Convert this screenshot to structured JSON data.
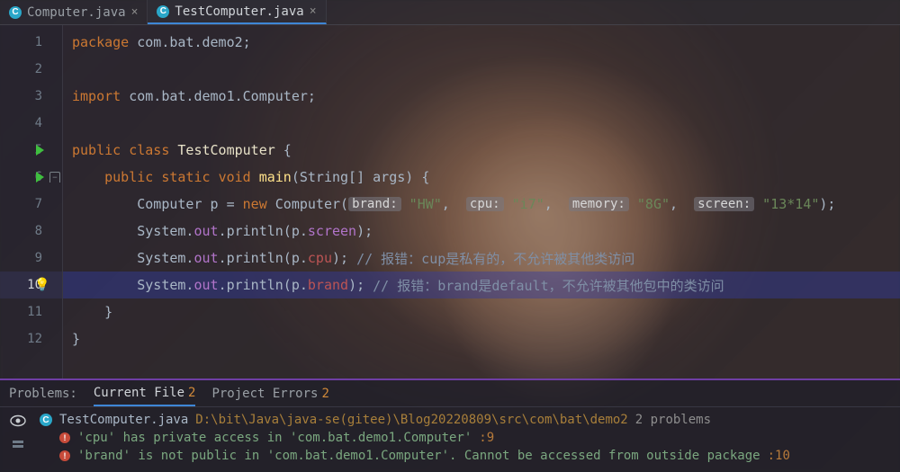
{
  "tabs": [
    {
      "label": "Computer.java",
      "active": false
    },
    {
      "label": "TestComputer.java",
      "active": true
    }
  ],
  "code": {
    "line1_pkg_kw": "package",
    "line1_pkg_val": "com.bat.demo2",
    "line3_imp_kw": "import",
    "line3_imp_val": "com.bat.demo1.Computer",
    "line5_public": "public",
    "line5_class": "class",
    "line5_name": "TestComputer",
    "line6_public": "public",
    "line6_static": "static",
    "line6_void": "void",
    "line6_main": "main",
    "line6_sig": "(String[] args) {",
    "line7_var": "Computer p ",
    "line7_eq": "= ",
    "line7_new": "new",
    "line7_ctor": " Computer(",
    "hint_brand": "brand:",
    "arg_brand": "\"HW\"",
    "hint_cpu": "cpu:",
    "arg_cpu": "\"i7\"",
    "hint_memory": "memory:",
    "arg_memory": "\"8G\"",
    "hint_screen": "screen:",
    "arg_screen": "\"13*14\"",
    "line7_end": ");",
    "sysout_pre": "System.",
    "sysout_out": "out",
    "sysout_call": ".println(p.",
    "f_screen": "screen",
    "f_cpu": "cpu",
    "f_brand": "brand",
    "close_paren": ");",
    "comment9": " // 报错：cup是私有的，不允许被其他类访问",
    "comment10": " // 报错：brand是default，不允许被其他包中的类访问",
    "brace_close": "}"
  },
  "gutter": [
    "1",
    "2",
    "3",
    "4",
    "5",
    "6",
    "7",
    "8",
    "9",
    "10",
    "11",
    "12"
  ],
  "problems": {
    "label": "Problems:",
    "tab_current": "Current File",
    "tab_current_count": "2",
    "tab_project": "Project Errors",
    "tab_project_count": "2",
    "file": "TestComputer.java",
    "path": "D:\\bit\\Java\\java-se(gitee)\\Blog20220809\\src\\com\\bat\\demo2",
    "count": "2 problems",
    "items": [
      {
        "msg": "'cpu' has private access in 'com.bat.demo1.Computer'",
        "loc": ":9"
      },
      {
        "msg": "'brand' is not public in 'com.bat.demo1.Computer'. Cannot be accessed from outside package",
        "loc": ":10"
      }
    ]
  }
}
